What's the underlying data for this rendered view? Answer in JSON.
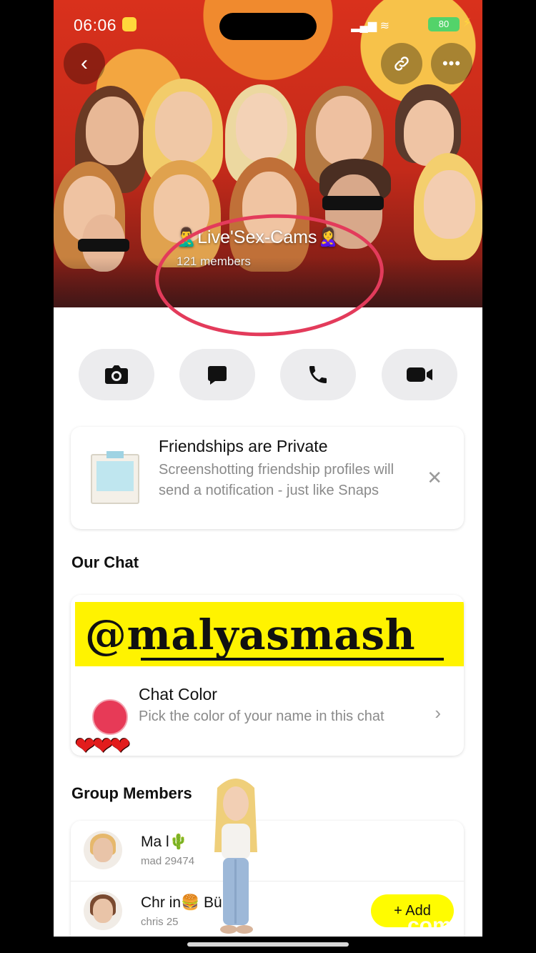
{
  "status_bar": {
    "time": "06:06",
    "battery": "80"
  },
  "group": {
    "name": "🙎‍♂️Live'Sex-Cams🙎‍♀️",
    "members": "121 members"
  },
  "icons": {
    "back": "chevron-left-icon",
    "link": "link-icon",
    "more": "more-dots-icon",
    "camera": "camera-icon",
    "chat": "chat-bubble-icon",
    "call": "phone-icon",
    "video": "video-icon"
  },
  "friendship_card": {
    "title": "Friendships are Private",
    "body": "Screenshotting friendship profiles will send a notification - just like Snaps"
  },
  "our_chat": {
    "heading": "Our Chat",
    "handle_banner": "@malyasmash",
    "color_title": "Chat Color",
    "color_subtitle": "Pick the color of your name in this chat",
    "color_value": "#e73a57"
  },
  "hearts": "❤❤❤",
  "group_members": {
    "heading": "Group Members",
    "rows": [
      {
        "name": "Ma    l🌵",
        "username": "mad     29474"
      },
      {
        "name": "Chr   in🍔 Bürger",
        "username": "chris     25",
        "add_label": "+ Add"
      }
    ]
  },
  "watermark": "com",
  "colors": {
    "accent": "#fffc00",
    "circle": "#e33b5b"
  }
}
